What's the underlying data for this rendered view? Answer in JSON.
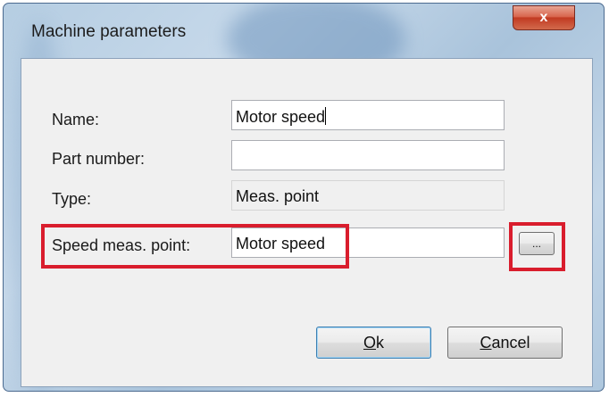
{
  "window": {
    "title": "Machine parameters",
    "close_glyph": "x"
  },
  "form": {
    "name_label": "Name:",
    "name_value": "Motor speed",
    "part_number_label": "Part number:",
    "part_number_value": "",
    "type_label": "Type:",
    "type_value": "Meas. point",
    "speed_label": "Speed meas. point:",
    "speed_value": "Motor speed",
    "browse_label": "..."
  },
  "buttons": {
    "ok_mnemonic": "O",
    "ok_rest": "k",
    "cancel_mnemonic": "C",
    "cancel_rest": "ancel"
  },
  "colors": {
    "highlight": "#d91d2d",
    "close_button": "#c13a22"
  }
}
